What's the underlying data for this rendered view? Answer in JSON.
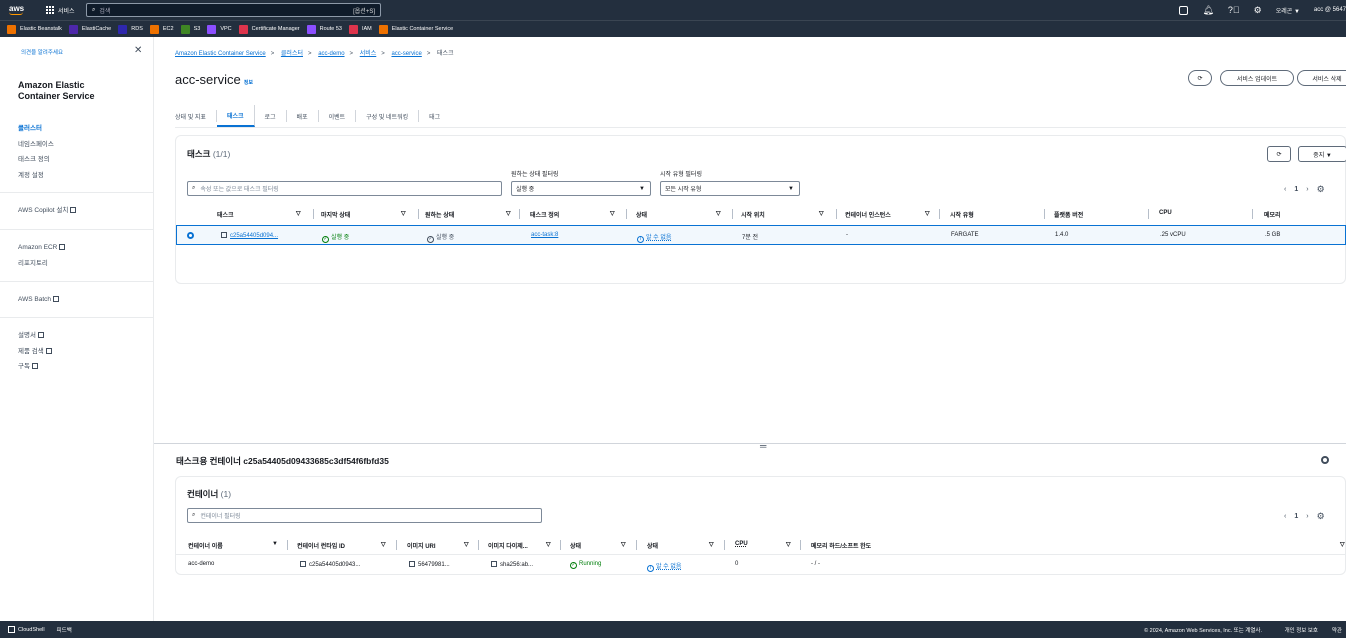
{
  "topnav": {
    "logo": "aws",
    "services_label": "서비스",
    "search_placeholder": "검색",
    "search_shortcut": "[옵션+S]",
    "region": "오레곤 ▼",
    "account": "acc @ 5647"
  },
  "favorites": [
    {
      "label": "Elastic Beanstalk",
      "color": "#ed7100"
    },
    {
      "label": "ElastiCache",
      "color": "#4d27aa"
    },
    {
      "label": "RDS",
      "color": "#2e27ad"
    },
    {
      "label": "EC2",
      "color": "#ed7100"
    },
    {
      "label": "S3",
      "color": "#3f8624"
    },
    {
      "label": "VPC",
      "color": "#8c4fff"
    },
    {
      "label": "Certificate Manager",
      "color": "#dd344c"
    },
    {
      "label": "Route 53",
      "color": "#8c4fff"
    },
    {
      "label": "IAM",
      "color": "#dd344c"
    },
    {
      "label": "Elastic Container Service",
      "color": "#ed7100"
    }
  ],
  "sidebar": {
    "feedback": "의견을 알려주세요",
    "title": "Amazon Elastic Container Service",
    "items": [
      "클러스터",
      "네임스페이스",
      "태스크 정의",
      "계정 설정"
    ],
    "copilot": "AWS Copilot 설치",
    "ecr": "Amazon ECR",
    "repo": "리포지토리",
    "batch": "AWS Batch",
    "docs": "설명서",
    "search": "제품 검색",
    "subscribe": "구독"
  },
  "breadcrumb": {
    "b1": "Amazon Elastic Container Service",
    "b2": "클러스터",
    "b3": "acc-demo",
    "b4": "서비스",
    "b5": "acc-service",
    "b6": "태스크"
  },
  "page": {
    "title": "acc-service",
    "info": "정보",
    "update_btn": "서비스 업데이트",
    "delete_btn": "서비스 삭제"
  },
  "tabs": [
    "상태 및 지표",
    "태스크",
    "로그",
    "배포",
    "이벤트",
    "구성 및 네트워킹",
    "태그"
  ],
  "tasks": {
    "title": "태스크",
    "count": "(1/1)",
    "stop_btn": "중지 ▼",
    "filter_placeholder": "속성 또는 값으로 태스크 필터링",
    "desired_label": "원하는 상태 필터링",
    "desired_value": "실행 중",
    "launch_label": "시작 유형 필터링",
    "launch_value": "모든 시작 유형",
    "page": "1",
    "headers": [
      "태스크",
      "마지막 상태",
      "원하는 상태",
      "태스크 정의",
      "상태",
      "시작 위치",
      "컨테이너 인스턴스",
      "시작 유형",
      "플랫폼 버전",
      "CPU",
      "메모리"
    ],
    "row": {
      "task": "c25a54405d094...",
      "last_status": "실행 중",
      "desired": "실행 중",
      "taskdef": "acc-task:8",
      "health": "알 수 없음",
      "started": "7분 전",
      "instance": "-",
      "launch_type": "FARGATE",
      "platform": "1.4.0",
      "cpu": ".25 vCPU",
      "memory": ".5 GB"
    }
  },
  "bottom": {
    "title": "태스크용 컨테이너 c25a54405d09433685c3df54f6fbfd35",
    "containers_title": "컨테이너",
    "containers_count": "(1)",
    "filter_placeholder": "컨테이너 필터링",
    "page": "1",
    "headers": [
      "컨테이너 이름",
      "컨테이너 런타임 ID",
      "이미지 URI",
      "이미지 다이제...",
      "상태",
      "상태",
      "CPU",
      "메모리 하드/소프트 한도"
    ],
    "row": {
      "name": "acc-demo",
      "runtime": "c25a54405d0943...",
      "image": "56479981...",
      "digest": "sha256:ab...",
      "status": "Running",
      "health": "알 수 없음",
      "cpu": "0",
      "memory": "- / -"
    }
  },
  "footer": {
    "cloudshell": "CloudShell",
    "feedback": "피드백",
    "copyright": "© 2024, Amazon Web Services, Inc. 또는 계열사.",
    "privacy": "개인 정보 보호",
    "terms": "약관"
  }
}
